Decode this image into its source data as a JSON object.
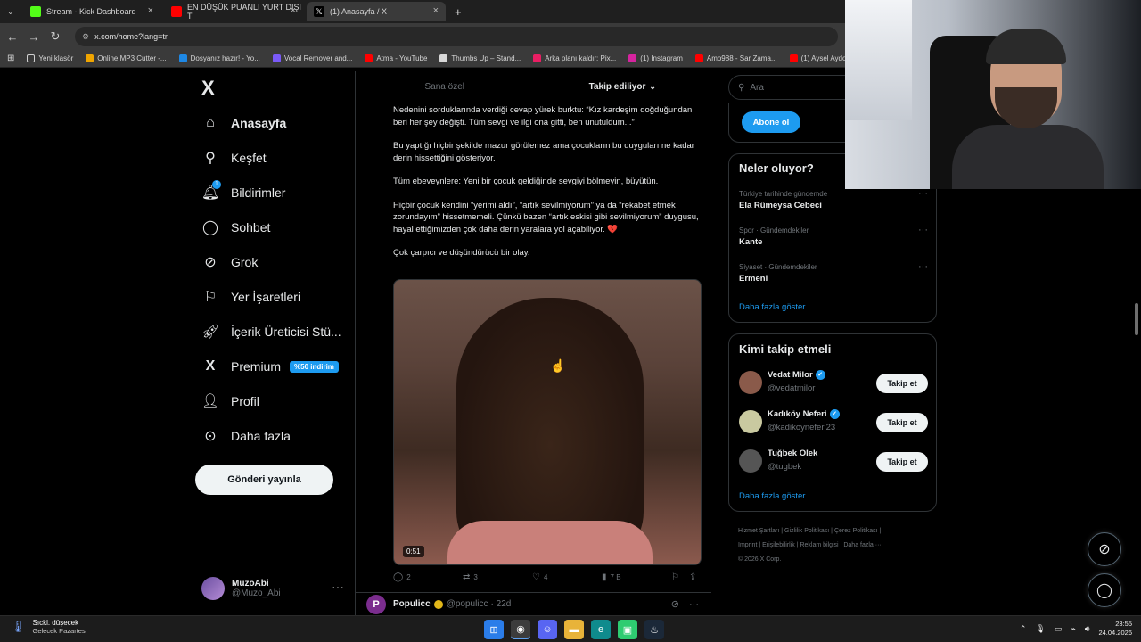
{
  "browser": {
    "tabs": [
      {
        "title": "Stream - Kick Dashboard",
        "favicon_color": "#53fc18"
      },
      {
        "title": "EN DÜŞÜK PUANLI YURT DIŞI T",
        "favicon_color": "#ff0000"
      },
      {
        "title": "(1) Anasayfa / X",
        "favicon_color": "#000000"
      }
    ],
    "new_tab": "+",
    "url": "x.com/home?lang=tr",
    "bookmarks": [
      {
        "label": "Yeni klasör",
        "color": "#d0d0d0"
      },
      {
        "label": "Online MP3 Cutter -...",
        "color": "#f0a500"
      },
      {
        "label": "Dosyanız hazır! - Yo...",
        "color": "#1e88e5"
      },
      {
        "label": "Vocal Remover and...",
        "color": "#7a5af8"
      },
      {
        "label": "Atma - YouTube",
        "color": "#ff0000"
      },
      {
        "label": "Thumbs Up – Stand...",
        "color": "#d8d8d8"
      },
      {
        "label": "Arka planı kaldır: Pix...",
        "color": "#e91e63"
      },
      {
        "label": "(1) Instagram",
        "color": "#d6249f"
      },
      {
        "label": "Amo988 - Sar Zama...",
        "color": "#ff0000"
      },
      {
        "label": "(1) Aysel Aydoğ...",
        "color": "#ff0000"
      }
    ]
  },
  "nav": {
    "logo": "X",
    "items": [
      {
        "label": "Anasayfa",
        "icon": "home-icon"
      },
      {
        "label": "Keşfet",
        "icon": "search-icon"
      },
      {
        "label": "Bildirimler",
        "icon": "bell-icon",
        "badge": "1"
      },
      {
        "label": "Sohbet",
        "icon": "chat-icon"
      },
      {
        "label": "Grok",
        "icon": "grok-icon"
      },
      {
        "label": "Yer İşaretleri",
        "icon": "bookmark-icon"
      },
      {
        "label": "İçerik Üreticisi Stü...",
        "icon": "rocket-icon"
      },
      {
        "label": "Premium",
        "icon": "x-icon"
      },
      {
        "label": "Profil",
        "icon": "person-icon"
      },
      {
        "label": "Daha fazla",
        "icon": "more-circle-icon"
      }
    ],
    "premium_badge": "%50 indirim",
    "post_button": "Gönderi yayınla",
    "profile": {
      "name": "MuzoAbi",
      "handle": "@Muzo_Abi",
      "more": "···"
    }
  },
  "feed": {
    "tabs": [
      {
        "label": "Sana özel",
        "active": false
      },
      {
        "label": "Takip ediliyor",
        "active": true
      }
    ],
    "tweet": {
      "paragraphs": [
        "Nedenini sorduklarında verdiği cevap yürek burktu: “Kız kardeşim doğduğundan beri her şey değişti. Tüm sevgi ve ilgi ona gitti, ben unutuldum...”",
        "Bu yaptığı hiçbir şekilde mazur görülemez ama çocukların bu duyguları ne kadar derin hissettiğini gösteriyor.",
        "Tüm ebeveynlere: Yeni bir çocuk geldiğinde sevgiyi bölmeyin, büyütün.",
        "Hiçbir çocuk kendini “yerimi aldı”, “artık sevilmiyorum” ya da “rekabet etmek zorundayım” hissetmemeli. Çünkü bazen “artık eskisi gibi sevilmiyorum” duygusu, hayal ettiğimizden çok daha derin yaralara yol açabiliyor. 💔",
        "Çok çarpıcı ve düşündürücü bir olay."
      ],
      "video_duration": "0:51",
      "replies": "2",
      "reposts": "3",
      "likes": "4",
      "views": "7 B"
    },
    "next_tweet": {
      "avatar_letter": "P",
      "name": "Populicc",
      "handle": "@populicc",
      "time": "· 22d"
    }
  },
  "sidebar": {
    "search_placeholder": "Ara",
    "subscribe": "Abone ol",
    "trends_title": "Neler oluyor?",
    "trends": [
      {
        "category": "Türkiye tarihinde gündemde",
        "name": "Ela Rümeysa Cebeci"
      },
      {
        "category": "Spor · Gündemdekiler",
        "name": "Kante"
      },
      {
        "category": "Siyaset · Gündemdekiler",
        "name": "Ermeni"
      }
    ],
    "trends_more": "Daha fazla göster",
    "wtf_title": "Kimi takip etmeli",
    "who_to_follow": [
      {
        "name": "Vedat Milor",
        "handle": "@vedatmilor",
        "avatar_color": "#8a5a4a"
      },
      {
        "name": "Kadıköy Neferi",
        "handle": "@kadikoyneferi23",
        "avatar_color": "#c9c9a0"
      },
      {
        "name": "Tuğbek Ölek",
        "handle": "@tugbek",
        "avatar_color": "#555555"
      }
    ],
    "follow_label": "Takip et",
    "wtf_more": "Daha fazla göster",
    "footer": {
      "line1": [
        "Hizmet Şartları",
        "Gizlilik Politikası",
        "Çerez Politikası"
      ],
      "line2": [
        "Imprint",
        "Erişilebilirlik",
        "Reklam bilgisi",
        "Daha fazla ···"
      ],
      "copyright": "© 2026 X Corp."
    }
  },
  "taskbar": {
    "weather_line1": "Sıckl. düşecek",
    "weather_line2": "Gelecek Pazartesi",
    "time": "23:55",
    "date": "24.04.2026"
  }
}
